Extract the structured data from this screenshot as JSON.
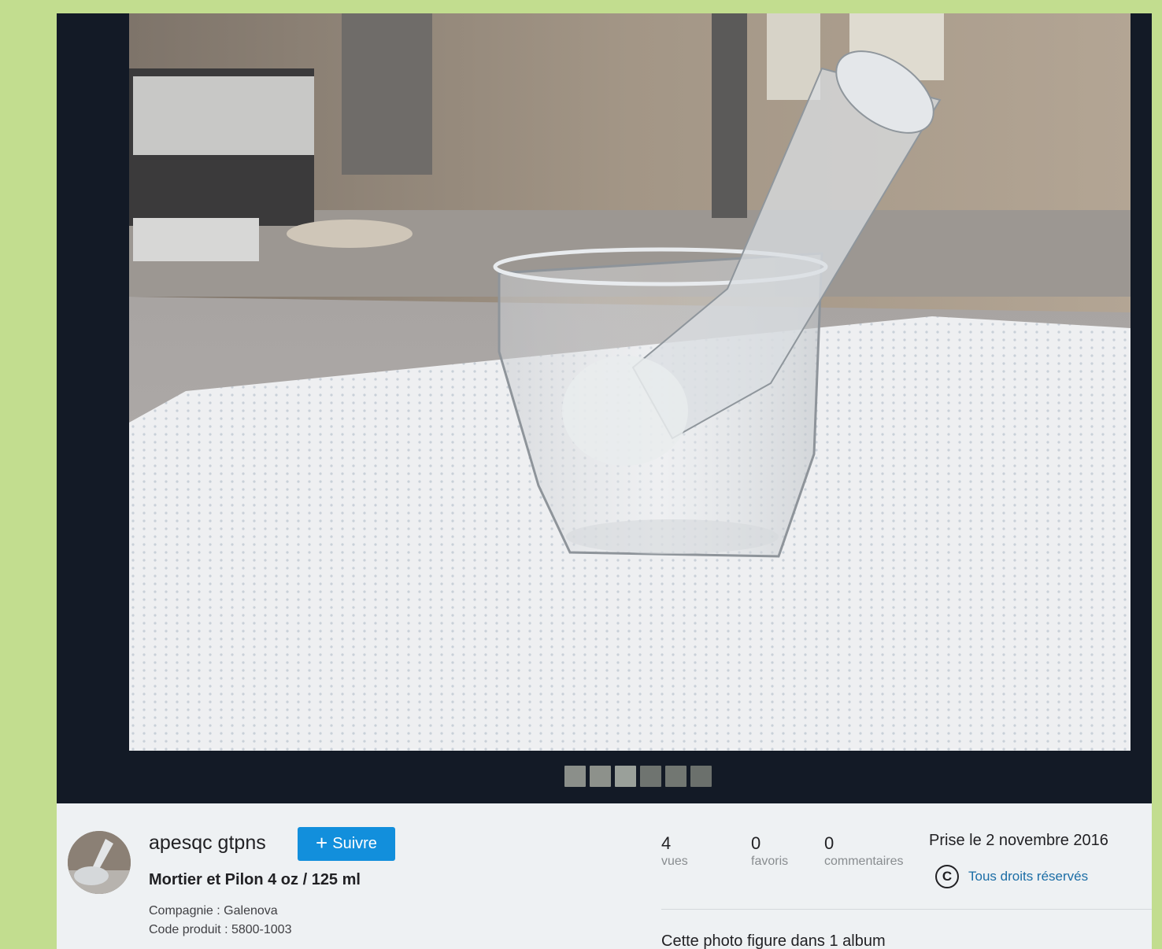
{
  "colors": {
    "page_bg": "#c2dd8f",
    "viewer_bg": "#131a26",
    "info_bg": "#eef1f3",
    "follow_button": "#128fdc",
    "link": "#1c6ea6"
  },
  "viewer": {
    "photo_subject": "mortar-and-pestle-photo",
    "thumbnails": [
      {
        "name": "thumbnail-1",
        "tone": "#8b8f8a"
      },
      {
        "name": "thumbnail-2",
        "tone": "#8d918b"
      },
      {
        "name": "thumbnail-3",
        "tone": "#9aa09a"
      },
      {
        "name": "thumbnail-4",
        "tone": "#6f7470"
      },
      {
        "name": "thumbnail-5",
        "tone": "#727772"
      },
      {
        "name": "thumbnail-6",
        "tone": "#6b706c"
      }
    ]
  },
  "owner": {
    "name": "apesqc gtpns",
    "follow_label": "Suivre",
    "follow_icon": "plus-icon"
  },
  "photo": {
    "title": "Mortier et Pilon 4 oz / 125 ml",
    "description": [
      "Compagnie : Galenova",
      "Code produit : 5800-1003"
    ]
  },
  "stats": [
    {
      "value": "4",
      "label": "vues"
    },
    {
      "value": "0",
      "label": "favoris"
    },
    {
      "value": "0",
      "label": "commentaires"
    }
  ],
  "meta": {
    "taken": "Prise le 2 novembre 2016",
    "license_icon": "copyright-icon",
    "license_symbol": "C",
    "license": "Tous droits réservés"
  },
  "albums_text": "Cette photo figure dans 1 album"
}
